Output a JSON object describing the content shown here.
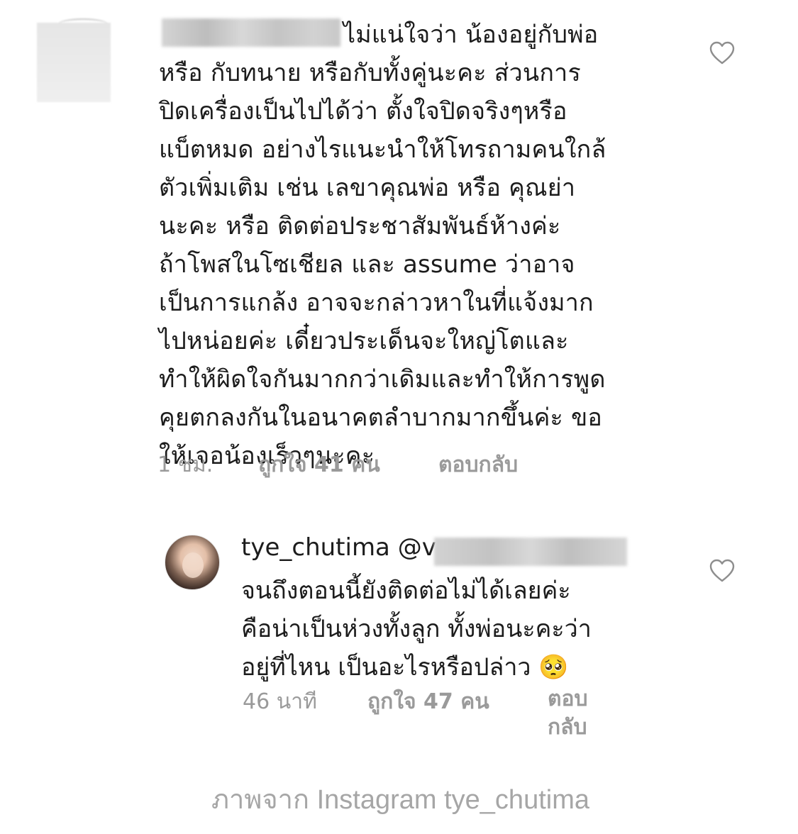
{
  "comments": [
    {
      "username": "",
      "text_lines": [
        "ไม่แน่ใจว่า น้องอยู่กับพ่อ",
        "หรือ กับทนาย หรือกับทั้งคู่นะคะ ส่วนการ",
        "ปิดเครื่องเป็นไปได้ว่า ตั้งใจปิดจริงๆหรือ",
        "แบ็ตหมด อย่างไรแนะนำให้โทรถามคนใกล้",
        "ตัวเพิ่มเติม เช่น เลขาคุณพ่อ หรือ คุณย่า",
        "นะคะ หรือ ติดต่อประชาสัมพันธ์ห้างค่ะ",
        "ถ้าโพสในโซเชียล และ assume ว่าอาจ",
        "เป็นการแกล้ง อาจจะกล่าวหาในที่แจ้งมาก",
        "ไปหน่อยค่ะ เดี๋ยวประเด็นจะใหญ่โตและ",
        "ทำให้ผิดใจกันมากกว่าเดิมและทำให้การพูด",
        "คุยตกลงกันในอนาคตลำบากมากขึ้นค่ะ ขอ",
        "ให้เจอน้องเร็วๆนะคะ"
      ],
      "time": "1 ชม.",
      "likes": "ถูกใจ 41 คน",
      "reply": "ตอบกลับ"
    },
    {
      "username": "tye_chutima",
      "mention": "@v",
      "text_lines": [
        "จนถึงตอนนี้ยังติดต่อไม่ได้เลยค่ะ",
        "คือน่าเป็นห่วงทั้งลูก ทั้งพ่อนะคะว่า",
        "อยู่ที่ไหน เป็นอะไรหรือปล่าว 🥺"
      ],
      "time": "46 นาที",
      "likes": "ถูกใจ 47 คน",
      "reply_line1": "ตอบ",
      "reply_line2": "กลับ"
    }
  ],
  "caption": "ภาพจาก Instagram tye_chutima",
  "icons": {
    "like": "heart-outline-icon"
  },
  "colors": {
    "text": "#1c1c1c",
    "meta": "#9a9a9a",
    "caption": "#a6a6a6"
  }
}
